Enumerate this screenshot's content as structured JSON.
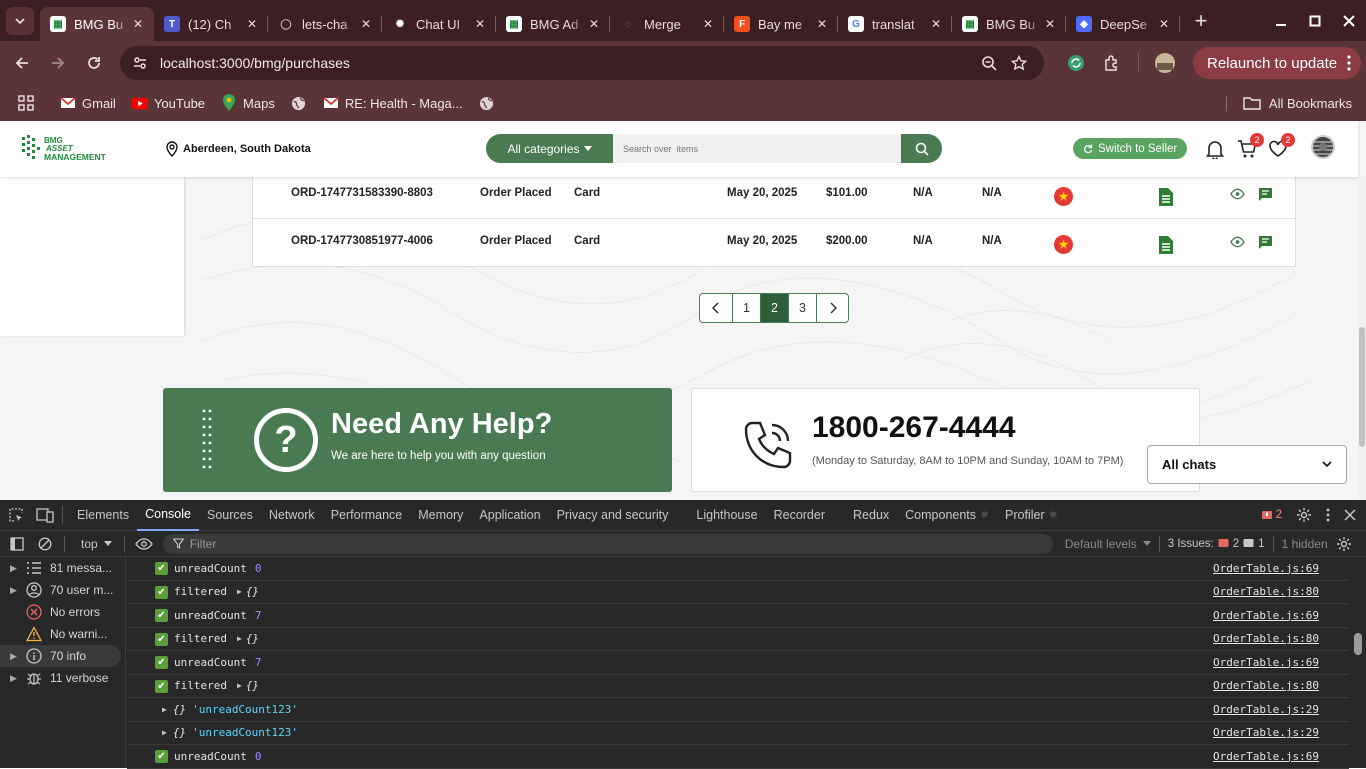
{
  "browser": {
    "tabs": [
      {
        "title": "BMG Bu",
        "icon": "bmg-logo-icon",
        "active": true
      },
      {
        "title": "(12) Ch",
        "icon": "teams-icon"
      },
      {
        "title": "lets-cha",
        "icon": "github-icon"
      },
      {
        "title": "Chat UI",
        "icon": "openai-icon"
      },
      {
        "title": "BMG Ad",
        "icon": "bmg-logo-icon"
      },
      {
        "title": "Merge",
        "icon": "loading-icon"
      },
      {
        "title": "Bay me",
        "icon": "figma-icon"
      },
      {
        "title": "translat",
        "icon": "google-icon"
      },
      {
        "title": "BMG Bu",
        "icon": "bmg-logo-icon"
      },
      {
        "title": "DeepSe",
        "icon": "deepseek-icon"
      }
    ],
    "url": "localhost:3000/bmg/purchases",
    "relaunch_label": "Relaunch to update",
    "bookmarks": [
      {
        "label": "Gmail",
        "icon": "gmail-icon"
      },
      {
        "label": "YouTube",
        "icon": "youtube-icon"
      },
      {
        "label": "Maps",
        "icon": "maps-icon"
      },
      {
        "label": "",
        "icon": "globe-icon"
      },
      {
        "label": "RE: Health - Maga...",
        "icon": "gmail-icon"
      },
      {
        "label": "",
        "icon": "globe-icon"
      }
    ],
    "all_bookmarks_label": "All Bookmarks"
  },
  "site": {
    "logo_text": [
      "BMG",
      "ASSET",
      "MANAGEMENT"
    ],
    "location": "Aberdeen, South Dakota",
    "category_label": "All categories",
    "search_placeholder": "Search over  items",
    "seller_label": "Switch to Seller",
    "cart_count": "2",
    "wishlist_count": "2",
    "accent": "#4a7a52"
  },
  "orders": [
    {
      "id": "ORD-1747731583390-8803",
      "status": "Order Placed",
      "payment": "Card",
      "date": "May 20, 2025",
      "amount": "$101.00",
      "col6": "N/A",
      "col7": "N/A"
    },
    {
      "id": "ORD-1747730851977-4006",
      "status": "Order Placed",
      "payment": "Card",
      "date": "May 20, 2025",
      "amount": "$200.00",
      "col6": "N/A",
      "col7": "N/A"
    }
  ],
  "pagination": {
    "prev": "‹",
    "pages": [
      "1",
      "2",
      "3"
    ],
    "current": "2",
    "next": "›"
  },
  "help": {
    "title": "Need Any Help?",
    "subtitle": "We are here to help you with any question",
    "icon_char": "?"
  },
  "contact": {
    "phone": "1800-267-4444",
    "hours": "(Monday to Saturday, 8AM to 10PM and Sunday, 10AM to 7PM)"
  },
  "chat_select": {
    "value": "All chats"
  },
  "devtools": {
    "tabs": [
      "Elements",
      "Console",
      "Sources",
      "Network",
      "Performance",
      "Memory",
      "Application",
      "Privacy and security",
      "Lighthouse",
      "Recorder",
      "Redux",
      "Components",
      "Profiler"
    ],
    "active_tab": "Console",
    "error_count": "2",
    "context": "top",
    "filter_placeholder": "Filter",
    "levels": "Default levels",
    "issues_label": "3 Issues:",
    "issues_errors": "2",
    "issues_info": "1",
    "hidden": "1 hidden",
    "sidebar": [
      {
        "label": "81 messa...",
        "icon": "list-icon"
      },
      {
        "label": "70 user m...",
        "icon": "user-icon"
      },
      {
        "label": "No errors",
        "icon": "error-icon"
      },
      {
        "label": "No warni...",
        "icon": "warning-icon"
      },
      {
        "label": "70 info",
        "icon": "info-icon"
      },
      {
        "label": "11 verbose",
        "icon": "bug-icon"
      }
    ],
    "logs": [
      {
        "kind": "check",
        "msg": "unreadCount",
        "val": "0",
        "src": "OrderTable.js:69"
      },
      {
        "kind": "check-obj",
        "msg": "filtered",
        "val": "{}",
        "src": "OrderTable.js:80"
      },
      {
        "kind": "check",
        "msg": "unreadCount",
        "val": "7",
        "src": "OrderTable.js:69"
      },
      {
        "kind": "check-obj",
        "msg": "filtered",
        "val": "{}",
        "src": "OrderTable.js:80"
      },
      {
        "kind": "check",
        "msg": "unreadCount",
        "val": "7",
        "src": "OrderTable.js:69"
      },
      {
        "kind": "check-obj",
        "msg": "filtered",
        "val": "{}",
        "src": "OrderTable.js:80"
      },
      {
        "kind": "obj-str",
        "msg": "{}",
        "val": "'unreadCount123'",
        "src": "OrderTable.js:29"
      },
      {
        "kind": "obj-str",
        "msg": "{}",
        "val": "'unreadCount123'",
        "src": "OrderTable.js:29"
      },
      {
        "kind": "check",
        "msg": "unreadCount",
        "val": "0",
        "src": "OrderTable.js:69"
      }
    ]
  }
}
